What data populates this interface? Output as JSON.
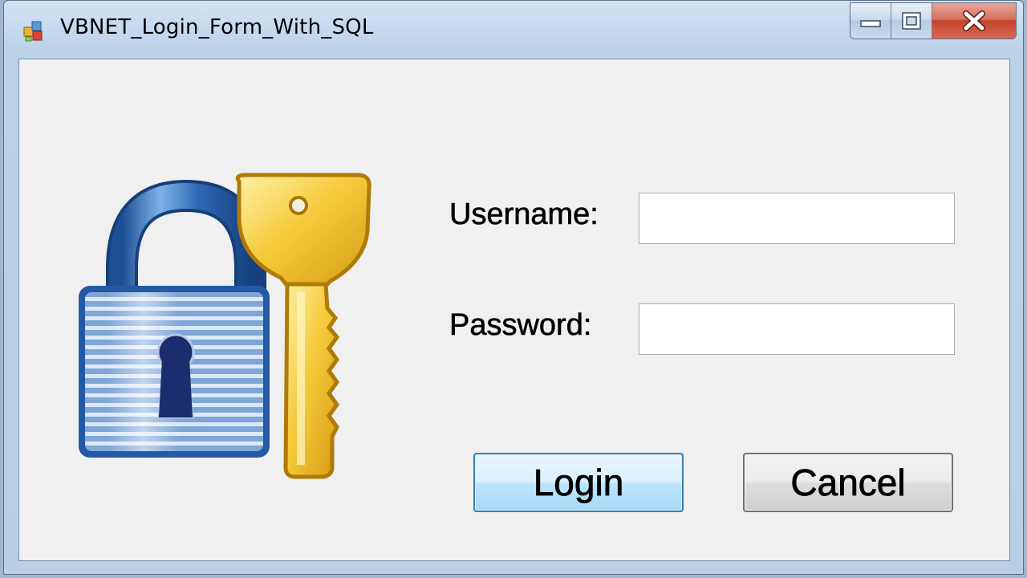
{
  "window": {
    "title": "VBNET_Login_Form_With_SQL",
    "controls": {
      "minimize_icon": "minimize-icon",
      "maximize_icon": "maximize-icon",
      "close_icon": "close-icon"
    }
  },
  "form": {
    "illustration_icon": "lock-and-key-icon",
    "username_label": "Username:",
    "username_value": "",
    "password_label": "Password:",
    "password_value": "",
    "login_label": "Login",
    "cancel_label": "Cancel"
  },
  "colors": {
    "client_bg": "#f0f0f0",
    "login_border": "#3c7fb1",
    "close_button": "#c4432c",
    "lock_blue": "#2a5ea8",
    "key_gold": "#e5b51e"
  }
}
